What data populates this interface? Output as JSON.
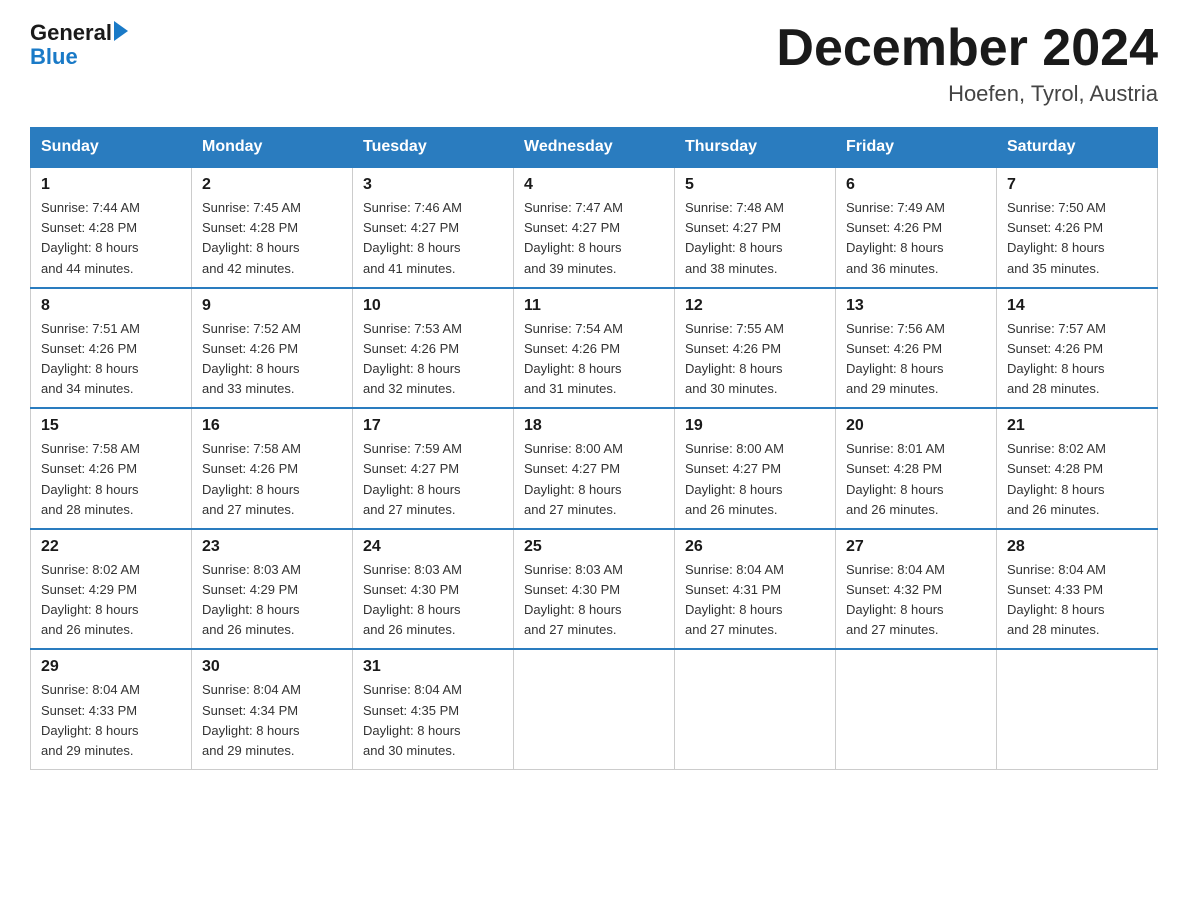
{
  "header": {
    "logo": {
      "general": "General",
      "blue": "Blue",
      "arrow": "▶"
    },
    "title": "December 2024",
    "location": "Hoefen, Tyrol, Austria"
  },
  "days_of_week": [
    "Sunday",
    "Monday",
    "Tuesday",
    "Wednesday",
    "Thursday",
    "Friday",
    "Saturday"
  ],
  "weeks": [
    [
      {
        "day": "1",
        "sunrise": "7:44 AM",
        "sunset": "4:28 PM",
        "daylight": "8 hours and 44 minutes."
      },
      {
        "day": "2",
        "sunrise": "7:45 AM",
        "sunset": "4:28 PM",
        "daylight": "8 hours and 42 minutes."
      },
      {
        "day": "3",
        "sunrise": "7:46 AM",
        "sunset": "4:27 PM",
        "daylight": "8 hours and 41 minutes."
      },
      {
        "day": "4",
        "sunrise": "7:47 AM",
        "sunset": "4:27 PM",
        "daylight": "8 hours and 39 minutes."
      },
      {
        "day": "5",
        "sunrise": "7:48 AM",
        "sunset": "4:27 PM",
        "daylight": "8 hours and 38 minutes."
      },
      {
        "day": "6",
        "sunrise": "7:49 AM",
        "sunset": "4:26 PM",
        "daylight": "8 hours and 36 minutes."
      },
      {
        "day": "7",
        "sunrise": "7:50 AM",
        "sunset": "4:26 PM",
        "daylight": "8 hours and 35 minutes."
      }
    ],
    [
      {
        "day": "8",
        "sunrise": "7:51 AM",
        "sunset": "4:26 PM",
        "daylight": "8 hours and 34 minutes."
      },
      {
        "day": "9",
        "sunrise": "7:52 AM",
        "sunset": "4:26 PM",
        "daylight": "8 hours and 33 minutes."
      },
      {
        "day": "10",
        "sunrise": "7:53 AM",
        "sunset": "4:26 PM",
        "daylight": "8 hours and 32 minutes."
      },
      {
        "day": "11",
        "sunrise": "7:54 AM",
        "sunset": "4:26 PM",
        "daylight": "8 hours and 31 minutes."
      },
      {
        "day": "12",
        "sunrise": "7:55 AM",
        "sunset": "4:26 PM",
        "daylight": "8 hours and 30 minutes."
      },
      {
        "day": "13",
        "sunrise": "7:56 AM",
        "sunset": "4:26 PM",
        "daylight": "8 hours and 29 minutes."
      },
      {
        "day": "14",
        "sunrise": "7:57 AM",
        "sunset": "4:26 PM",
        "daylight": "8 hours and 28 minutes."
      }
    ],
    [
      {
        "day": "15",
        "sunrise": "7:58 AM",
        "sunset": "4:26 PM",
        "daylight": "8 hours and 28 minutes."
      },
      {
        "day": "16",
        "sunrise": "7:58 AM",
        "sunset": "4:26 PM",
        "daylight": "8 hours and 27 minutes."
      },
      {
        "day": "17",
        "sunrise": "7:59 AM",
        "sunset": "4:27 PM",
        "daylight": "8 hours and 27 minutes."
      },
      {
        "day": "18",
        "sunrise": "8:00 AM",
        "sunset": "4:27 PM",
        "daylight": "8 hours and 27 minutes."
      },
      {
        "day": "19",
        "sunrise": "8:00 AM",
        "sunset": "4:27 PM",
        "daylight": "8 hours and 26 minutes."
      },
      {
        "day": "20",
        "sunrise": "8:01 AM",
        "sunset": "4:28 PM",
        "daylight": "8 hours and 26 minutes."
      },
      {
        "day": "21",
        "sunrise": "8:02 AM",
        "sunset": "4:28 PM",
        "daylight": "8 hours and 26 minutes."
      }
    ],
    [
      {
        "day": "22",
        "sunrise": "8:02 AM",
        "sunset": "4:29 PM",
        "daylight": "8 hours and 26 minutes."
      },
      {
        "day": "23",
        "sunrise": "8:03 AM",
        "sunset": "4:29 PM",
        "daylight": "8 hours and 26 minutes."
      },
      {
        "day": "24",
        "sunrise": "8:03 AM",
        "sunset": "4:30 PM",
        "daylight": "8 hours and 26 minutes."
      },
      {
        "day": "25",
        "sunrise": "8:03 AM",
        "sunset": "4:30 PM",
        "daylight": "8 hours and 27 minutes."
      },
      {
        "day": "26",
        "sunrise": "8:04 AM",
        "sunset": "4:31 PM",
        "daylight": "8 hours and 27 minutes."
      },
      {
        "day": "27",
        "sunrise": "8:04 AM",
        "sunset": "4:32 PM",
        "daylight": "8 hours and 27 minutes."
      },
      {
        "day": "28",
        "sunrise": "8:04 AM",
        "sunset": "4:33 PM",
        "daylight": "8 hours and 28 minutes."
      }
    ],
    [
      {
        "day": "29",
        "sunrise": "8:04 AM",
        "sunset": "4:33 PM",
        "daylight": "8 hours and 29 minutes."
      },
      {
        "day": "30",
        "sunrise": "8:04 AM",
        "sunset": "4:34 PM",
        "daylight": "8 hours and 29 minutes."
      },
      {
        "day": "31",
        "sunrise": "8:04 AM",
        "sunset": "4:35 PM",
        "daylight": "8 hours and 30 minutes."
      },
      null,
      null,
      null,
      null
    ]
  ],
  "labels": {
    "sunrise": "Sunrise:",
    "sunset": "Sunset:",
    "daylight": "Daylight:"
  },
  "colors": {
    "header_bg": "#2a7cbf",
    "header_text": "#ffffff",
    "border_top": "#2a7cbf",
    "cell_border": "#cccccc"
  }
}
